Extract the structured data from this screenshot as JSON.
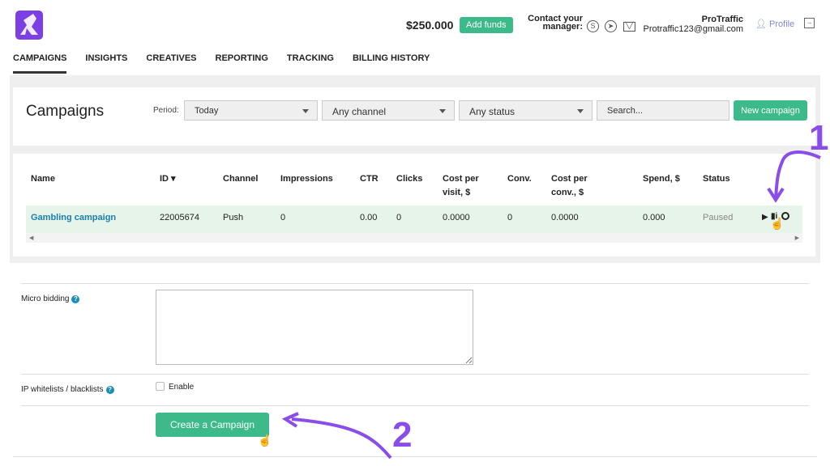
{
  "header": {
    "balance": "$250.000",
    "add_funds": "Add funds",
    "contact_label_1": "Contact your",
    "contact_label_2": "manager:",
    "user_name": "ProTraffic",
    "user_email": "Protraffic123@gmail.com",
    "profile": "Profile",
    "brand_color": "#7b3fe4"
  },
  "nav": [
    "CAMPAIGNS",
    "INSIGHTS",
    "CREATIVES",
    "REPORTING",
    "TRACKING",
    "BILLING HISTORY"
  ],
  "campaigns": {
    "title": "Campaigns",
    "period_label": "Period:",
    "period": "Today",
    "channel": "Any channel",
    "status": "Any status",
    "search_placeholder": "Search...",
    "new_campaign": "New campaign"
  },
  "table": {
    "headers": [
      "Name",
      "ID ▾",
      "Channel",
      "Impressions",
      "CTR",
      "Clicks",
      "Cost per\nvisit, $",
      "Conv.",
      "Cost per\nconv., $",
      "Spend, $",
      "Status"
    ],
    "rows": [
      {
        "name": "Gambling campaign",
        "id": "22005674",
        "channel": "Push",
        "impressions": "0",
        "ctr": "0.00",
        "clicks": "0",
        "cpv": "0.0000",
        "conv": "0",
        "cpc": "0.0000",
        "spend": "0.000",
        "status": "Paused"
      }
    ]
  },
  "form": {
    "micro_bidding": "Micro bidding",
    "ip_lists": "IP whitelists / blacklists",
    "enable": "Enable",
    "create": "Create a Campaign",
    "help": "?"
  },
  "annotations": {
    "one": "1",
    "two": "2",
    "color": "#8a4dea"
  }
}
